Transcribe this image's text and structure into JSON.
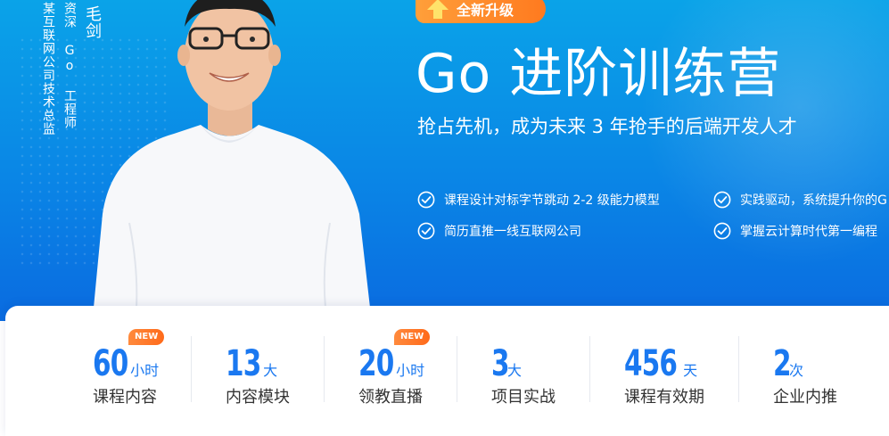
{
  "instructor": {
    "name": "毛剑",
    "role": "资深 Go 工程师",
    "organization": "某互联网公司技术总监"
  },
  "badge": {
    "label": "全新升级"
  },
  "hero": {
    "title": "Go 进阶训练营",
    "subtitle": "抢占先机，成为未来 3 年抢手的后端开发人才"
  },
  "features": [
    "课程设计对标字节跳动 2-2 级能力模型",
    "实践驱动，系统提升你的G",
    "简历直推一线互联网公司",
    "掌握云计算时代第一编程"
  ],
  "stats": [
    {
      "value": "60",
      "unit": "小时",
      "label": "课程内容",
      "tag": "NEW"
    },
    {
      "value": "13",
      "unit": "大",
      "label": "内容模块",
      "tag": ""
    },
    {
      "value": "20",
      "unit": "小时",
      "label": "领教直播",
      "tag": "NEW"
    },
    {
      "value": "3",
      "unit": "大",
      "label": "项目实战",
      "tag": ""
    },
    {
      "value": "456",
      "unit": "天",
      "label": "课程有效期",
      "tag": ""
    },
    {
      "value": "2",
      "unit": "次",
      "label": "企业内推",
      "tag": ""
    }
  ],
  "colors": {
    "hero_top": "#0aa3e8",
    "hero_bottom": "#0a6be0",
    "accent_blue": "#1a78f0",
    "badge_orange": "#ff7a1f"
  }
}
